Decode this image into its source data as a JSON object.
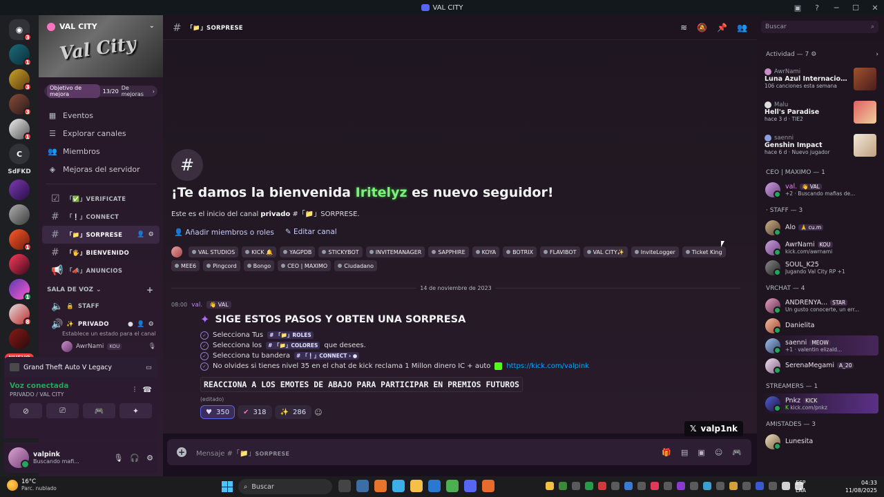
{
  "window": {
    "title": "VAL CITY"
  },
  "rail": {
    "badges": [
      "3",
      "1",
      "3",
      "3",
      "1",
      "1",
      "8",
      "1"
    ],
    "letter": "C",
    "text_server": "SdFKD",
    "nuevo": "NUEVO"
  },
  "server": {
    "name": "VAL CITY",
    "banner_text": "Val City",
    "boost_label": "Objetivo de mejora",
    "boost_count": "13/20",
    "boost_suffix": "De mejoras"
  },
  "nav": {
    "eventos": "Eventos",
    "explorar": "Explorar canales",
    "miembros": "Miembros",
    "mejoras": "Mejoras del servidor"
  },
  "channels": [
    {
      "name": "「✅」VERIFICATE"
    },
    {
      "name": "「❕」CONNECT"
    },
    {
      "name": "「📁」SORPRESE"
    },
    {
      "name": "「🖐」BIENVENIDO"
    },
    {
      "name": "「📣」ANUNCIOS"
    }
  ],
  "voice_category": "SALA DE VOZ",
  "voice_channels": {
    "staff": "STAFF",
    "privado": "PRIVADO",
    "privado_status": "Establece un estado para el canal",
    "user": "AwrNami",
    "user_tag": "KOU"
  },
  "activity": {
    "game": "Grand Theft Auto V Legacy"
  },
  "voice_panel": {
    "connected": "Voz conectada",
    "location": "PRIVADO / VAL CITY"
  },
  "user_panel": {
    "name": "valpink",
    "status": "Buscando mafi..."
  },
  "header": {
    "channel": "「📁」SORPRESE",
    "search_placeholder": "Buscar"
  },
  "welcome": {
    "title_prefix": "¡Te damos la bienvenida",
    "title_highlight": "Iritelyz",
    "title_suffix": "es nuevo seguidor!",
    "sub_prefix": "Este es el inicio del canal",
    "sub_bold": "privado",
    "sub_channel": "#「📁」SORPRESE.",
    "add_members": "Añadir miembros o roles",
    "edit_channel": "Editar canal"
  },
  "tags": [
    "VAL STUDIOS",
    "KICK 🔔",
    "YAGPDB",
    "STICKYBOT",
    "INVITEMANAGER",
    "SAPPHIRE",
    "KOYA",
    "BOTRIX",
    "FLAVIBOT",
    "VAL CITY✨",
    "InviteLogger",
    "Ticket King",
    "MEE6",
    "Pingcord",
    "Bongo",
    "CEO | MAXIMO",
    "Ciudadano"
  ],
  "date_separator": "14 de noviembre de 2023",
  "message": {
    "time": "08:00",
    "author": "val.",
    "role": "👋 VAL",
    "heading": "SIGE ESTOS PASOS Y OBTEN UNA SORPRESA",
    "step1_text": "Selecciona Tus",
    "step1_mention": "ROLES",
    "step2_text": "Selecciona los",
    "step2_mention": "COLORES",
    "step2_suffix": "que desees.",
    "step3_text": "Selecciona tu bandera",
    "step3_mention": "CONNECT",
    "step4_text": "No olvides si tienes nivel 35 en el chat de kick reclama 1 Millon dinero IC + auto",
    "step4_link": "https://kick.com/valpink",
    "code": "REACCIONA A LOS EMOTES DE ABAJO PARA PARTICIPAR EN PREMIOS FUTUROS",
    "edited": "(editado)",
    "reactions": [
      "350",
      "318",
      "286"
    ]
  },
  "x_badge": "valp1nk",
  "composer": {
    "placeholder_prefix": "Mensaje #「📁」",
    "placeholder_channel": "SORPRESE"
  },
  "members": {
    "activity_header": "Actividad — 7",
    "activities": [
      {
        "user": "AwrNami",
        "game": "Luna Azul Internacional D' E...",
        "detail": "106 canciones esta semana"
      },
      {
        "user": "Malu",
        "game": "Hell's Paradise",
        "detail": "hace 3 d · TIE2"
      },
      {
        "user": "saenni",
        "game": "Genshin Impact",
        "detail": "hace 6 d · Nuevo jugador"
      }
    ],
    "groups": [
      {
        "title": "CEO | MAXIMO — 1",
        "members": [
          {
            "name": "val.",
            "role": "👋 VAL",
            "status": "+2 · Buscando mafias de..."
          }
        ]
      },
      {
        "title": "· STAFF — 3",
        "members": [
          {
            "name": "Alo",
            "role": "🙏 cu.m",
            "status": ""
          },
          {
            "name": "AwrNami",
            "role": "KOU",
            "status": "kick.com/awrnami"
          },
          {
            "name": "SOUL_K25",
            "role": "",
            "status": "Jugando Val City RP +1"
          }
        ]
      },
      {
        "title": "VRCHAT — 4",
        "members": [
          {
            "name": "ANDRENYA...",
            "role": "STAR",
            "status": "Un gusto conocerte, un err..."
          },
          {
            "name": "Danielita",
            "role": "",
            "status": ""
          },
          {
            "name": "saenni",
            "role": "MEOW",
            "status": "+1 · valentin elizald..."
          },
          {
            "name": "SerenaMegami",
            "role": "A_20",
            "status": ""
          }
        ]
      },
      {
        "title": "STREAMERS — 1",
        "members": [
          {
            "name": "Pnkz",
            "role": "KICK",
            "status": "kick.com/pnkz"
          }
        ]
      },
      {
        "title": "AMISTADES — 3",
        "members": [
          {
            "name": "Lunesita",
            "role": "",
            "status": ""
          }
        ]
      }
    ]
  },
  "taskbar": {
    "temp": "16°C",
    "weather": "Parc. nublado",
    "search": "Buscar",
    "lang1": "ESP",
    "lang2": "LAA",
    "time": "04:33",
    "date": "11/08/2025"
  }
}
